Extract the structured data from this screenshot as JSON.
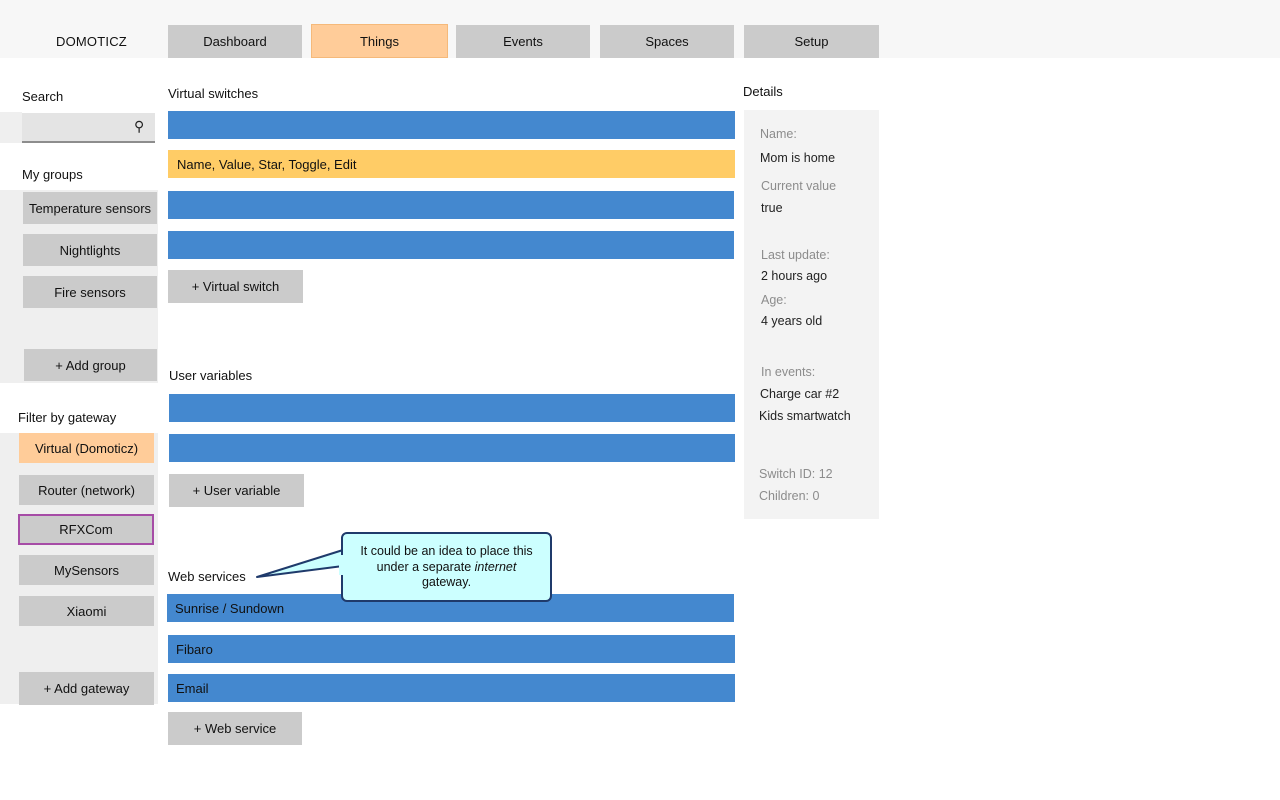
{
  "brand": "DOMOTICZ",
  "nav": {
    "tabs": [
      {
        "label": "Dashboard"
      },
      {
        "label": "Things"
      },
      {
        "label": "Events"
      },
      {
        "label": "Spaces"
      },
      {
        "label": "Setup"
      }
    ],
    "active_tab": "Things"
  },
  "sidebar": {
    "search_label": "Search",
    "search_value": "",
    "groups_label": "My groups",
    "groups": [
      "Temperature sensors",
      "Nightlights",
      "Fire sensors"
    ],
    "add_group": "+ Add group",
    "gateway_label": "Filter by gateway",
    "gateways": [
      "Virtual (Domoticz)",
      "Router (network)",
      "RFXCom",
      "MySensors",
      "Xiaomi"
    ],
    "add_gateway": "+ Add gateway"
  },
  "main": {
    "virtual_switches": {
      "title": "Virtual switches",
      "rows": [
        "",
        "Name, Value, Star, Toggle, Edit",
        "",
        ""
      ],
      "add_label": "+ Virtual switch"
    },
    "user_variables": {
      "title": "User variables",
      "rows": [
        "",
        ""
      ],
      "add_label": "+ User variable"
    },
    "web_services": {
      "title": "Web services",
      "rows": [
        "Sunrise / Sundown",
        "Fibaro",
        "Email"
      ],
      "add_label": "+ Web service"
    }
  },
  "callout": {
    "line1": "It could be an idea to place this",
    "line2_pre": "under a separate ",
    "line2_em": "internet",
    "line3": "gateway."
  },
  "details": {
    "title": "Details",
    "name_label": "Name:",
    "name_value": "Mom is home",
    "current_label": "Current value",
    "current_value": "true",
    "last_update_label": "Last update:",
    "last_update_value": "2 hours ago",
    "age_label": "Age:",
    "age_value": "4 years old",
    "events_label": "In events:",
    "events": [
      "Charge car #2",
      "Kids smartwatch"
    ],
    "switch_id": "Switch ID: 12",
    "children": "Children: 0"
  },
  "colors": {
    "bar_blue": "#4488cf",
    "highlight_yellow": "#ffcc66",
    "active_orange": "#ffcc99",
    "button_gray": "#cbcbcb",
    "selected_border": "#a64ca6",
    "callout_fill": "#ccffff"
  }
}
